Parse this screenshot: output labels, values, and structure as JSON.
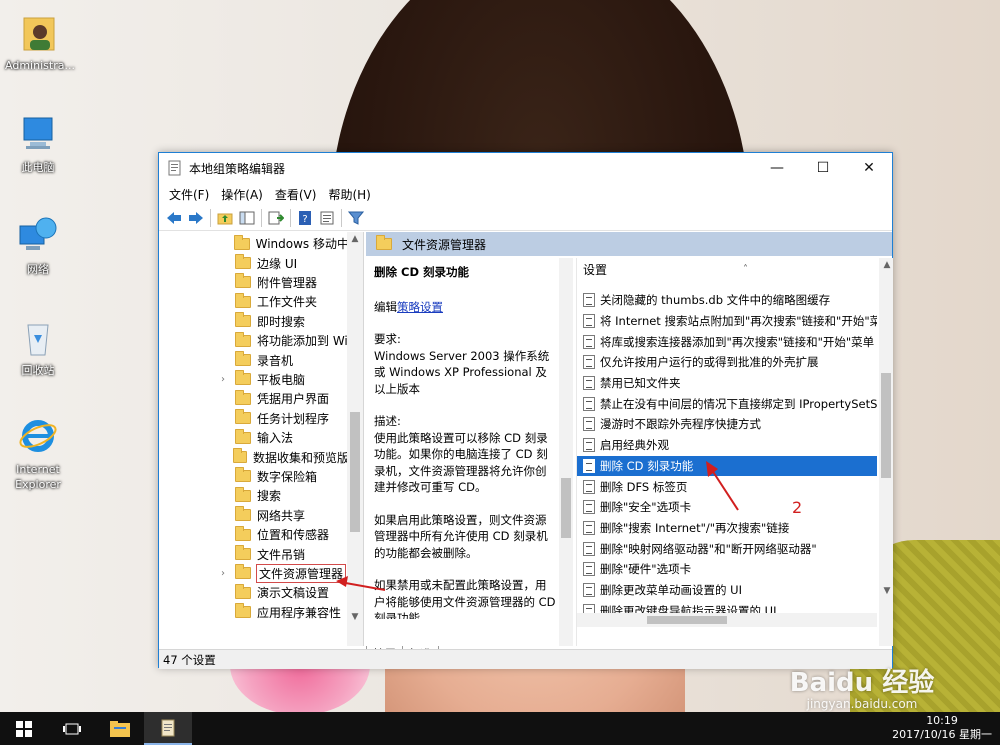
{
  "desktop": {
    "icons": [
      {
        "label": "Administra...",
        "icon": "user-folder-icon"
      },
      {
        "label": "此电脑",
        "icon": "computer-icon"
      },
      {
        "label": "网络",
        "icon": "network-icon"
      },
      {
        "label": "回收站",
        "icon": "recycle-bin-icon"
      },
      {
        "label": "Internet Explorer",
        "icon": "ie-icon"
      }
    ]
  },
  "window": {
    "title": "本地组策略编辑器",
    "controls": {
      "minimize": "—",
      "maximize": "☐",
      "close": "✕"
    },
    "menu": [
      "文件(F)",
      "操作(A)",
      "查看(V)",
      "帮助(H)"
    ],
    "toolbar": [
      "back-icon",
      "forward-icon",
      "up-folder-icon",
      "show-hide-tree-icon",
      "export-list-icon",
      "help-icon",
      "properties-icon",
      "filter-icon"
    ]
  },
  "tree": {
    "items": [
      {
        "label": "Windows 移动中",
        "expandable": false
      },
      {
        "label": "边缘 UI",
        "expandable": false
      },
      {
        "label": "附件管理器",
        "expandable": false
      },
      {
        "label": "工作文件夹",
        "expandable": false
      },
      {
        "label": "即时搜索",
        "expandable": false
      },
      {
        "label": "将功能添加到 Wi",
        "expandable": false
      },
      {
        "label": "录音机",
        "expandable": false
      },
      {
        "label": "平板电脑",
        "expandable": true
      },
      {
        "label": "凭据用户界面",
        "expandable": false
      },
      {
        "label": "任务计划程序",
        "expandable": false
      },
      {
        "label": "输入法",
        "expandable": false
      },
      {
        "label": "数据收集和预览版",
        "expandable": false
      },
      {
        "label": "数字保险箱",
        "expandable": false
      },
      {
        "label": "搜索",
        "expandable": false
      },
      {
        "label": "网络共享",
        "expandable": false
      },
      {
        "label": "位置和传感器",
        "expandable": false
      },
      {
        "label": "文件吊销",
        "expandable": false
      },
      {
        "label": "文件资源管理器",
        "expandable": true,
        "selected": true
      },
      {
        "label": "演示文稿设置",
        "expandable": false
      },
      {
        "label": "应用程序兼容性",
        "expandable": false
      }
    ]
  },
  "detail": {
    "header": "文件资源管理器",
    "policy_title": "删除 CD 刻录功能",
    "edit_prefix": "编辑",
    "edit_link": "策略设置",
    "requirements_label": "要求:",
    "requirements": "Windows Server 2003 操作系统或 Windows XP Professional 及以上版本",
    "description_label": "描述:",
    "description": "使用此策略设置可以移除 CD 刻录功能。如果你的电脑连接了 CD 刻录机，文件资源管理器将允许你创建并修改可重写 CD。",
    "description_2": "如果启用此策略设置，则文件资源管理器中所有允许使用 CD 刻录机的功能都会被删除。",
    "description_3": "如果禁用或未配置此策略设置，用户将能够使用文件资源管理器的 CD 刻录功能。"
  },
  "list": {
    "column": "设置",
    "rows": [
      "关闭隐藏的 thumbs.db 文件中的缩略图缓存",
      "将 Internet 搜索站点附加到\"再次搜索\"链接和\"开始\"菜单",
      "将库或搜索连接器添加到\"再次搜索\"链接和\"开始\"菜单",
      "仅允许按用户运行的或得到批准的外壳扩展",
      "禁用已知文件夹",
      "禁止在没有中间层的情况下直接绑定到 IPropertySetStorage",
      "漫游时不跟踪外壳程序快捷方式",
      "启用经典外观",
      "删除 CD 刻录功能",
      "删除 DFS 标签页",
      "删除\"安全\"选项卡",
      "删除\"搜索 Internet\"/\"再次搜索\"链接",
      "删除\"映射网络驱动器\"和\"断开网络驱动器\"",
      "删除\"硬件\"选项卡",
      "删除更改菜单动画设置的 UI",
      "删除更改键盘导航指示器设置的 UI"
    ],
    "selected_index": 8
  },
  "tabs": [
    "扩展",
    "标准"
  ],
  "status": "47 个设置",
  "annotation_number": "2",
  "taskbar": {
    "time": "10:19",
    "date": "2017/10/16 星期一",
    "watermark": "Baidu 经验",
    "watermark_sub": "jingyan.baidu.com"
  }
}
